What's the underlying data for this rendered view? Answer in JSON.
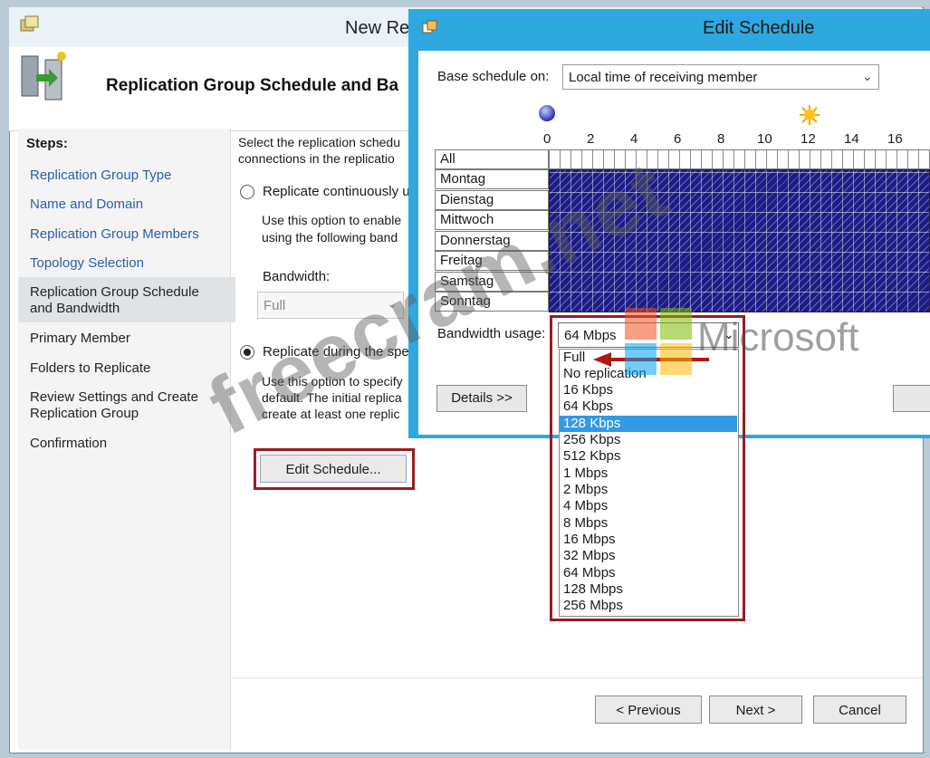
{
  "wizard": {
    "title": "New Re",
    "header_title": "Replication Group Schedule and Ba",
    "steps_heading": "Steps:",
    "steps": [
      "Replication Group Type",
      "Name and Domain",
      "Replication Group Members",
      "Topology Selection",
      "Replication Group Schedule and Bandwidth",
      "Primary Member",
      "Folders to Replicate",
      "Review Settings and Create Replication Group",
      "Confirmation"
    ],
    "intro_line1": "Select the replication schedu",
    "intro_line2": "connections in the replicatio",
    "option1_label": "Replicate continuously u",
    "option1_desc1": "Use this option to enable",
    "option1_desc2": "using the following band",
    "bandwidth_label": "Bandwidth:",
    "bandwidth_value": "Full",
    "option2_label": "Replicate during the spe",
    "option2_desc1": "Use this option to specify",
    "option2_desc2": "default. The initial replica",
    "option2_desc3": "create at least one replic",
    "edit_schedule_button": "Edit Schedule...",
    "previous_button": "< Previous",
    "next_button": "Next >",
    "cancel_button": "Cancel"
  },
  "dialog": {
    "title": "Edit Schedule",
    "base_label": "Base schedule on:",
    "base_value": "Local time of receiving member",
    "hours": [
      "0",
      "2",
      "4",
      "6",
      "8",
      "10",
      "12",
      "14",
      "16"
    ],
    "rows": [
      "All",
      "Montag",
      "Dienstag",
      "Mittwoch",
      "Donnerstag",
      "Freitag",
      "Samstag",
      "Sonntag"
    ],
    "bandwidth_usage_label": "Bandwidth usage:",
    "bandwidth_usage_value": "64 Mbps",
    "details_button": "Details >>",
    "options": [
      "Full",
      "No replication",
      "16 Kbps",
      "64 Kbps",
      "128 Kbps",
      "256 Kbps",
      "512 Kbps",
      "1 Mbps",
      "2 Mbps",
      "4 Mbps",
      "8 Mbps",
      "16 Mbps",
      "32 Mbps",
      "64 Mbps",
      "128 Mbps",
      "256 Mbps"
    ],
    "selected_option": "128 Kbps"
  },
  "watermark": {
    "text": "freecram.net",
    "brand": "Microsoft"
  },
  "colors": {
    "dialog_frame": "#2fa8e0",
    "schedule_fill": "#1c1c86",
    "highlight_border": "#9b1c24",
    "selection": "#3399e6",
    "link_blue": "#2b5fa8"
  }
}
